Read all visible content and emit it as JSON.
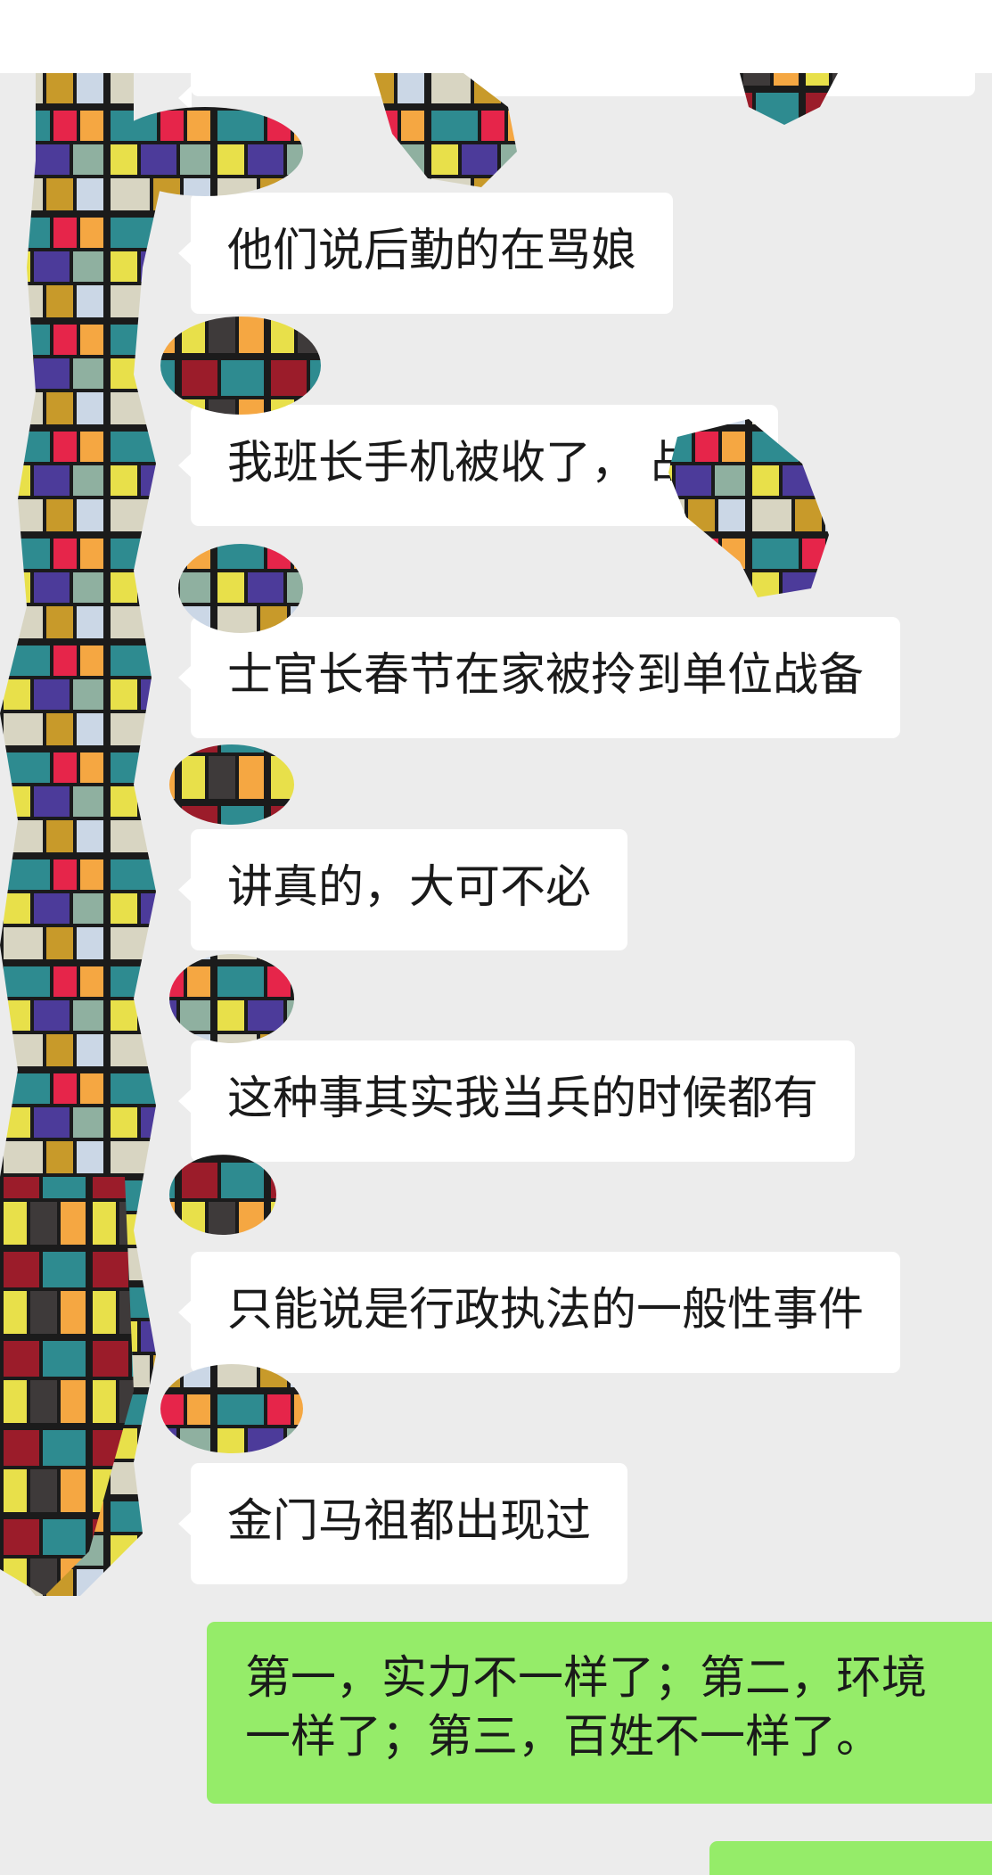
{
  "messages": [
    {
      "sender": "contact",
      "text": "他们说后勤的在骂娘"
    },
    {
      "sender": "contact",
      "text": "我班长手机被收了，    战备"
    },
    {
      "sender": "contact",
      "text": "士官长春节在家被拎到单位战备"
    },
    {
      "sender": "contact",
      "text": "讲真的，大可不必"
    },
    {
      "sender": "contact",
      "text": "这种事其实我当兵的时候都有"
    },
    {
      "sender": "contact",
      "text": "只能说是行政执法的一般性事件"
    },
    {
      "sender": "contact",
      "text": "金门马祖都出现过"
    },
    {
      "sender": "me",
      "text": "第一，实力不一样了；第二，环境\n一样了；第三，百姓不一样了。"
    }
  ],
  "colors": {
    "chat_background": "#ececec",
    "incoming_bubble": "#ffffff",
    "outgoing_bubble": "#95ec69",
    "mosaic_palette": [
      "#2e8b90",
      "#e6254a",
      "#f5a742",
      "#4c3b9a",
      "#e8e04a",
      "#d8d5c2",
      "#8fb0a0",
      "#cbd7e6",
      "#3e3a3a",
      "#c89a2a",
      "#9b1c2a"
    ]
  },
  "icons": {
    "avatar": "mosaic-redaction",
    "censor_overlay": "mosaic-redaction"
  }
}
